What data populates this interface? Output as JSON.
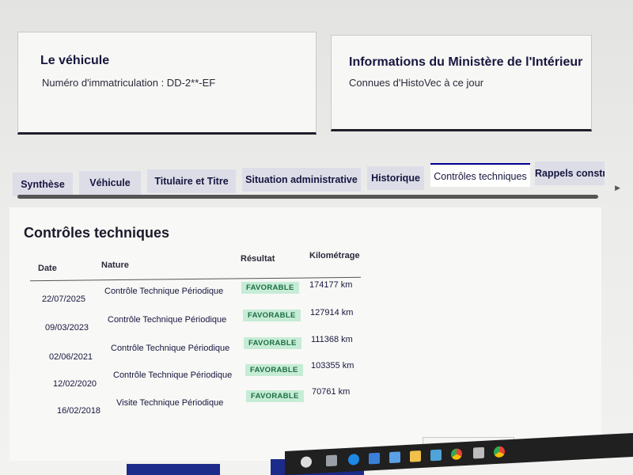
{
  "vehicle_card": {
    "title": "Le véhicule",
    "registration": "Numéro d'immatriculation : DD-2**-EF"
  },
  "ministry_card": {
    "title": "Informations du Ministère de l'Intérieur",
    "subtitle": "Connues d'HistoVec à ce jour"
  },
  "tabs": [
    {
      "label": "Synthèse",
      "active": false
    },
    {
      "label": "Véhicule",
      "active": false
    },
    {
      "label": "Titulaire et Titre",
      "active": false
    },
    {
      "label": "Situation administrative",
      "active": false
    },
    {
      "label": "Historique",
      "active": false
    },
    {
      "label": "Contrôles techniques",
      "active": true
    },
    {
      "label": "Rappels constru",
      "active": false
    }
  ],
  "section": {
    "title": "Contrôles techniques"
  },
  "table": {
    "headers": {
      "date": "Date",
      "nature": "Nature",
      "result": "Résultat",
      "mileage": "Kilométrage"
    },
    "rows": [
      {
        "date": "22/07/2025",
        "nature": "Contrôle Technique Périodique",
        "result": "FAVORABLE",
        "mileage": "174177 km"
      },
      {
        "date": "09/03/2023",
        "nature": "Contrôle Technique Périodique",
        "result": "FAVORABLE",
        "mileage": "127914 km"
      },
      {
        "date": "02/06/2021",
        "nature": "Contrôle Technique Périodique",
        "result": "FAVORABLE",
        "mileage": "111368 km"
      },
      {
        "date": "12/02/2020",
        "nature": "Contrôle Technique Périodique",
        "result": "FAVORABLE",
        "mileage": "103355 km"
      },
      {
        "date": "16/02/2018",
        "nature": "Visite Technique Périodique",
        "result": "FAVORABLE",
        "mileage": "70761 km"
      }
    ]
  },
  "colors": {
    "brand_blue": "#000091",
    "badge_green_text": "#1d6e43",
    "badge_green_bg": "#c6ecd6"
  },
  "taskbar_icons": [
    "search-icon",
    "task-view-icon",
    "edge-icon",
    "store-icon",
    "mail-icon",
    "folder-icon",
    "network-icon",
    "chrome-icon",
    "chrome-icon",
    "chrome-icon"
  ]
}
